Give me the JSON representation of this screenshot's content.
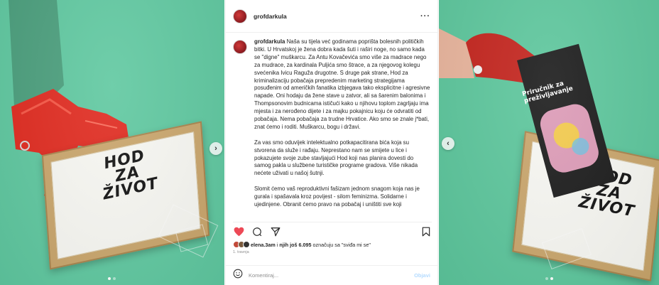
{
  "left_image": {
    "poster_lines": [
      "HOD",
      "ZA",
      "ŽIVOT"
    ]
  },
  "right_image": {
    "poster_lines": [
      "HOD",
      "ZA",
      "ŽIVOT"
    ],
    "book_title": "Priručnik za preživljavanje"
  },
  "post": {
    "username": "grofdarkula",
    "caption_paragraphs": [
      "Naša su tijela već godinama poprišta bolesnih političkih bitki. U Hrvatskoj je žena dobra kada šuti i raširi noge, no samo kada se \"digne\" muškarcu. Za Antu Kovačevića smo više za madrace nego za mudrace, za kardinala Puljića smo štrace, a za njegovog kolegu svećenika Ivicu Raguža drugotne. S druge pak strane, Hod za kriminalizaciju pobačaja prepredenim marketing strategijama posuđenim od američkih fanatika izbjegava tako eksplicitne i agresivne napade. Oni hodaju da žene stave u zatvor, ali sa šarenim balonima i Thompsonovim budnicama ističući kako u njihovu toplom zagrljaju ima mjesta i za nerođeno dijete i za majku pokajnicu koju će odvratiti od pobačaja. Nema pobačaja za trudne Hrvatice. Ako smo se znale j*bati, znat ćemo i roditi. Muškarcu, bogu i državi.",
      "Za vas smo oduvijek intelektualno potkapacitirana bića koja su stvorena da služe i rađaju. Neprestano nam se smijete u lice i pokazujete svoje zube stavljajući Hod koji nas planira dovesti do samog pakla u službene turističke programe gradova. Više nikada nećete uživati u našoj šutnji.",
      "Slomit ćemo vaš reproduktivni fašizam jednom snagom koja nas je gurala i spašavala kroz povijest - silom feminizma. Solidarne i ujedinjene. Obranit ćemo pravo na pobačaj i uništiti sve koji"
    ],
    "likes": {
      "first_user": "elena.3am",
      "connector": "i",
      "others": "njih još 6.095",
      "suffix": "označuju sa \"sviđa mi se\""
    },
    "date": "1. travnja",
    "comment_placeholder": "Komentiraj...",
    "post_button_label": "Objavi"
  },
  "icons": {
    "heart": "heart-icon",
    "comment": "comment-icon",
    "share": "share-icon",
    "bookmark": "bookmark-icon",
    "emoji": "emoji-icon",
    "more": "more-options-icon"
  },
  "colors": {
    "background_green": "#5fc8a0",
    "heart_red": "#ed4956",
    "boot_red": "#e02a1f",
    "post_button": "#b3dbff"
  }
}
